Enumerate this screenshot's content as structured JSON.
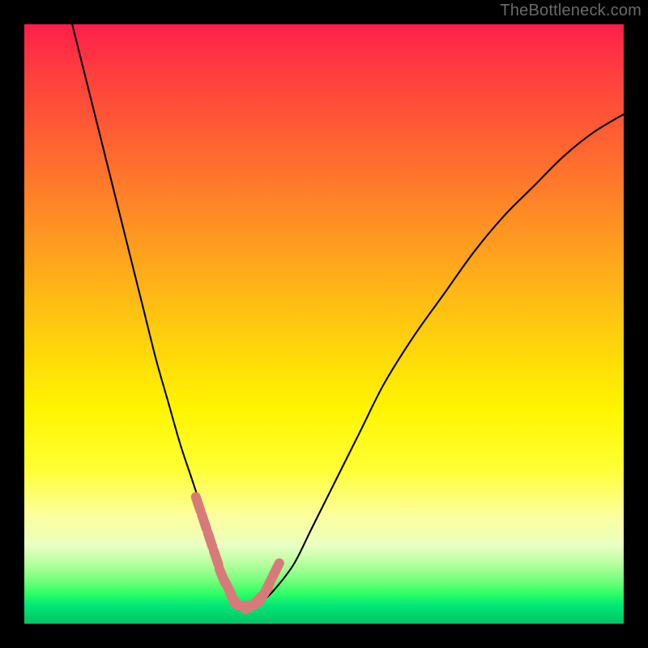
{
  "watermark": "TheBottleneck.com",
  "colors": {
    "marker_stroke": "#d97a7a",
    "curve_stroke": "#000000",
    "frame_bg": "#000000"
  },
  "chart_data": {
    "type": "line",
    "title": "",
    "xlabel": "",
    "ylabel": "",
    "xlim": [
      0,
      100
    ],
    "ylim": [
      0,
      100
    ],
    "grid": false,
    "legend": false,
    "series": [
      {
        "name": "bottleneck-curve",
        "x": [
          8,
          10,
          12,
          14,
          16,
          18,
          20,
          22,
          24,
          26,
          28,
          30,
          32,
          33,
          34,
          35,
          36,
          37,
          38,
          40,
          42,
          45,
          48,
          52,
          56,
          60,
          65,
          70,
          75,
          80,
          85,
          90,
          95,
          100
        ],
        "values": [
          100,
          92,
          84,
          76,
          68,
          60,
          52,
          44,
          37,
          30,
          24,
          18,
          12,
          9,
          6,
          4,
          3,
          3,
          3,
          4,
          6,
          10,
          16,
          24,
          32,
          40,
          48,
          55,
          62,
          68,
          73,
          78,
          82,
          85
        ]
      }
    ],
    "markers": [
      {
        "series": "bottleneck-curve",
        "x": [
          29,
          30,
          31,
          32,
          33,
          34,
          35,
          36,
          37,
          38,
          39,
          40,
          41,
          42
        ],
        "values": [
          20,
          17,
          14,
          11,
          8,
          6,
          4,
          3,
          3,
          3,
          4,
          5,
          7,
          9
        ],
        "style": "thick-dotted",
        "color": "#d97a7a"
      }
    ]
  }
}
